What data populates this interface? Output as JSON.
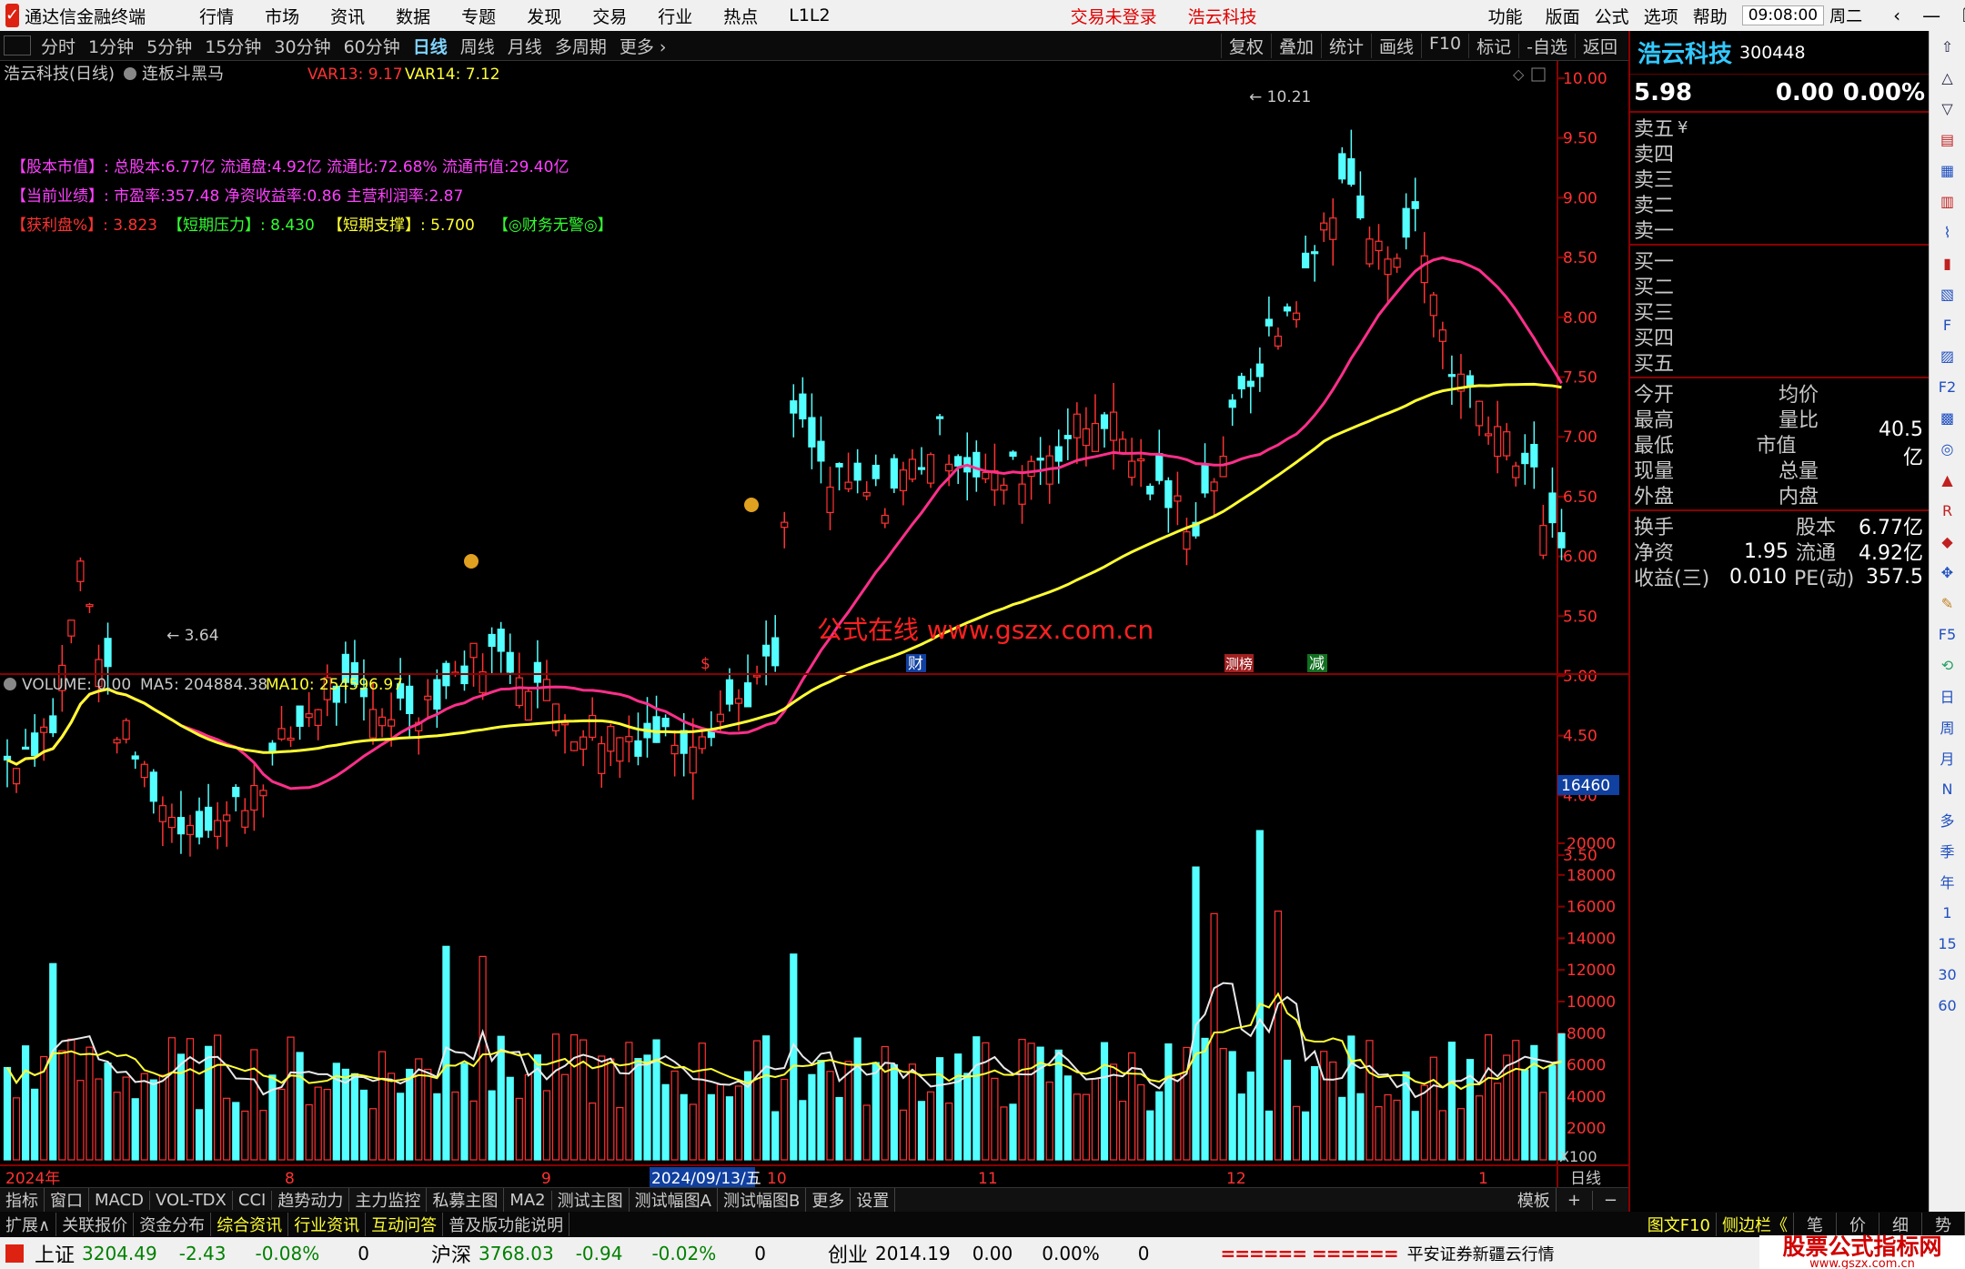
{
  "titlebar": {
    "app_name": "通达信金融终端",
    "menus": [
      "行情",
      "市场",
      "资讯",
      "数据",
      "专题",
      "发现",
      "交易",
      "行业",
      "热点",
      "L1L2"
    ],
    "center": [
      "交易未登录",
      "浩云科技"
    ],
    "right_menus": [
      "功能",
      "版面",
      "公式",
      "选项",
      "帮助"
    ],
    "time": "09:08:00",
    "weekday": "周二"
  },
  "toolbar": {
    "periods": [
      "分时",
      "1分钟",
      "5分钟",
      "15分钟",
      "30分钟",
      "60分钟",
      "日线",
      "周线",
      "月线",
      "多周期",
      "更多 ›"
    ],
    "active": "日线",
    "right_buttons": [
      "复权",
      "叠加",
      "统计",
      "画线",
      "F10",
      "标记",
      "-自选",
      "返回"
    ]
  },
  "chart_header": {
    "title": "浩云科技(日线)",
    "indicator": "连板斗黑马",
    "var13": "VAR13: 9.17",
    "var14": "VAR14: 7.12"
  },
  "info_lines": {
    "line1": "【股本市值】: 总股本:6.77亿 流通盘:4.92亿 流通比:72.68% 流通市值:29.40亿",
    "line2": "【当前业绩】: 市盈率:357.48 净资收益率:0.86 主营利润率:2.87",
    "line3_a": "【获利盘%】: 3.823",
    "line3_b": "【短期压力】: 8.430",
    "line3_c": "【短期支撑】: 5.700",
    "line3_d": "【◎财务无警◎】"
  },
  "price_chart": {
    "y_labels": [
      "10.00",
      "9.50",
      "9.00",
      "8.50",
      "8.00",
      "7.50",
      "7.00",
      "6.50",
      "6.00",
      "5.50",
      "5.00",
      "4.50",
      "4.00",
      "3.50"
    ],
    "high_label": "10.21",
    "low_label": "3.64",
    "watermark": "公式在线 www.gszx.com.cn",
    "markers": [
      "$",
      "财",
      "测榜",
      "减"
    ],
    "colors": {
      "up": "#ff3232",
      "down": "#54ffff",
      "ma_pink": "#ff2f8a",
      "ma_yellow": "#ffff32"
    }
  },
  "volume_chart": {
    "header_volume": "VOLUME: 0.00",
    "header_ma5": "MA5: 204884.38",
    "header_ma10": "MA10: 254596.97",
    "y_labels": [
      "20000",
      "18000",
      "16000",
      "14000",
      "12000",
      "10000",
      "8000",
      "6000",
      "4000",
      "2000"
    ],
    "cursor_value": "16460",
    "unit": "X100"
  },
  "x_axis": {
    "labels": [
      "2024年",
      "8",
      "9",
      "2024/09/13/五",
      "10",
      "11",
      "12",
      "1"
    ],
    "period": "日线"
  },
  "bottom_tabs": {
    "items": [
      "指标",
      "窗口",
      "MACD",
      "VOL-TDX",
      "CCI",
      "趋势动力",
      "主力监控",
      "私募主图",
      "MA2",
      "测试主图",
      "测试幅图A",
      "测试幅图B",
      "更多",
      "设置"
    ],
    "right": [
      "模板",
      "+",
      "−"
    ]
  },
  "info_tabs": {
    "items": [
      "扩展∧",
      "关联报价",
      "资金分布",
      "综合资讯",
      "行业资讯",
      "互动问答",
      "普及版功能说明"
    ],
    "right": [
      "图文F10",
      "侧边栏《",
      "笔",
      "价",
      "细",
      "势"
    ]
  },
  "status": {
    "sh_name": "上证",
    "sh_val": "3204.49",
    "sh_chg": "-2.43",
    "sh_pct": "-0.08%",
    "sh_vol": "0",
    "sz_name": "沪深",
    "sz_val": "3768.03",
    "sz_chg": "-0.94",
    "sz_pct": "-0.02%",
    "sz_vol": "0",
    "cy_name": "创业",
    "cy_val": "2014.19",
    "cy_chg": "0.00",
    "cy_pct": "0.00%",
    "cy_vol": "0",
    "broker": "平安证券新疆云行情",
    "brand": "股票公式指标网",
    "brand_url": "www.gszx.com.cn"
  },
  "quote_panel": {
    "name": "浩云科技",
    "code": "300448",
    "price": "5.98",
    "change": "0.00",
    "pct": "0.00%",
    "sell": [
      "卖五",
      "卖四",
      "卖三",
      "卖二",
      "卖一"
    ],
    "sell_unit": "¥",
    "buy": [
      "买一",
      "买二",
      "买三",
      "买四",
      "买五"
    ],
    "stats": [
      {
        "l": "今开",
        "v": "",
        "l2": "均价",
        "v2": ""
      },
      {
        "l": "最高",
        "v": "",
        "l2": "量比",
        "v2": ""
      },
      {
        "l": "最低",
        "v": "",
        "l2": "市值",
        "v2": "40.5亿"
      },
      {
        "l": "现量",
        "v": "",
        "l2": "总量",
        "v2": ""
      },
      {
        "l": "外盘",
        "v": "",
        "l2": "内盘",
        "v2": ""
      }
    ],
    "fin": [
      {
        "l": "换手",
        "v": "",
        "l2": "股本",
        "v2": "6.77亿"
      },
      {
        "l": "净资",
        "v": "1.95",
        "l2": "流通",
        "v2": "4.92亿"
      },
      {
        "l": "收益(三)",
        "v": "0.010",
        "l2": "PE(动)",
        "v2": "357.5"
      }
    ]
  },
  "sidebar": {
    "items": [
      "日",
      "周",
      "月",
      "N",
      "多",
      "季",
      "年",
      "1",
      "15",
      "30",
      "60"
    ]
  }
}
